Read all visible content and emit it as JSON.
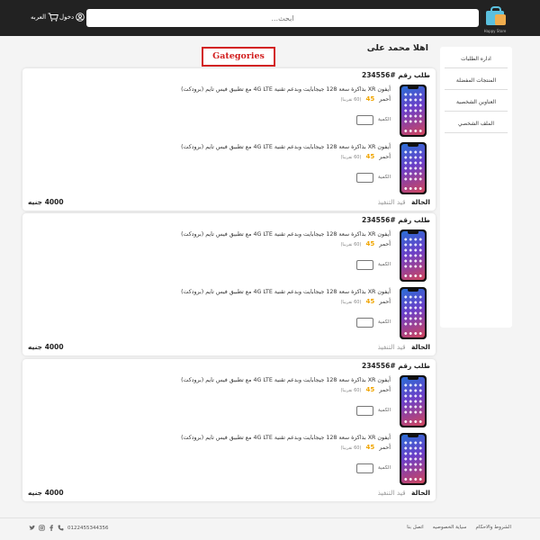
{
  "header": {
    "logo_text": "Happy Store",
    "search_placeholder": "ابحث...",
    "login_label": "دخول",
    "cart_label": "العربه"
  },
  "sidebar": {
    "items": [
      {
        "label": "اداره الطلبات"
      },
      {
        "label": "المنتجات المفضلة"
      },
      {
        "label": "العناوين الشخصية"
      },
      {
        "label": "الملف الشخصي"
      }
    ]
  },
  "greeting": "اهلا محمد على",
  "categories_label": "Gategories",
  "order_item": {
    "name": "أيفون XR بذاكرة سعة 128 جيجابايت وبدعم تقنية 4G LTE مع تطبيق فيس تايم (برودكت) أحمر",
    "price": "45",
    "old_price": "(60 تقريبا)",
    "qty_label": "الكمية"
  },
  "orders": [
    {
      "title": "طلب رقم #234556",
      "status_label": "الحالة",
      "status_value": "قيد التنفيذ",
      "total": "4000 جنيه"
    },
    {
      "title": "طلب رقم #234556",
      "status_label": "الحالة",
      "status_value": "قيد التنفيذ",
      "total": "4000 جنيه"
    },
    {
      "title": "طلب رقم #234556",
      "status_label": "الحالة",
      "status_value": "قيد التنفيذ",
      "total": "4000 جنيه"
    }
  ],
  "footer": {
    "links": [
      "الشروط والاحكام",
      "سياية الخصوصيه",
      "اتصل بنا"
    ],
    "phone": "0122455344356",
    "social_icons": [
      "phone-icon",
      "facebook-icon",
      "instagram-icon",
      "twitter-icon"
    ]
  }
}
